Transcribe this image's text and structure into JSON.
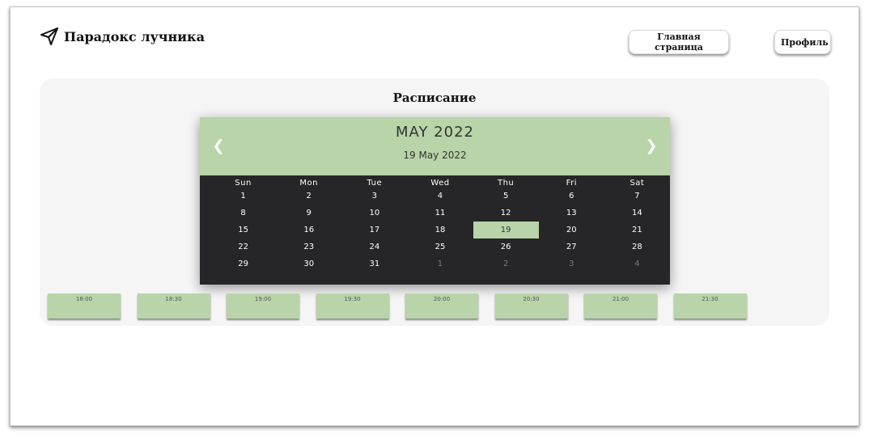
{
  "header": {
    "brand_name": "Парадокс лучника",
    "brand_icon": "paper-plane-icon",
    "nav": {
      "home_label": "Главная страница",
      "profile_label": "Профиль"
    }
  },
  "schedule": {
    "title": "Расписание",
    "calendar": {
      "month_year": "MAY 2022",
      "selected_date_text": "19 May 2022",
      "prev_icon": "chevron-left-icon",
      "next_icon": "chevron-right-icon",
      "weekdays": [
        "Sun",
        "Mon",
        "Tue",
        "Wed",
        "Thu",
        "Fri",
        "Sat"
      ],
      "weeks": [
        [
          "1",
          "2",
          "3",
          "4",
          "5",
          "6",
          "7"
        ],
        [
          "8",
          "9",
          "10",
          "11",
          "12",
          "13",
          "14"
        ],
        [
          "15",
          "16",
          "17",
          "18",
          "19",
          "20",
          "21"
        ],
        [
          "22",
          "23",
          "24",
          "25",
          "26",
          "27",
          "28"
        ],
        [
          "29",
          "30",
          "31",
          "1",
          "2",
          "3",
          "4"
        ]
      ],
      "selected_day": "19"
    },
    "time_slots": [
      "18:00",
      "18:30",
      "19:00",
      "19:30",
      "20:00",
      "20:30",
      "21:00",
      "21:30"
    ]
  },
  "colors": {
    "accent_green": "#b8d4a8",
    "calendar_dark": "#262628",
    "panel_bg": "#f5f5f5"
  }
}
